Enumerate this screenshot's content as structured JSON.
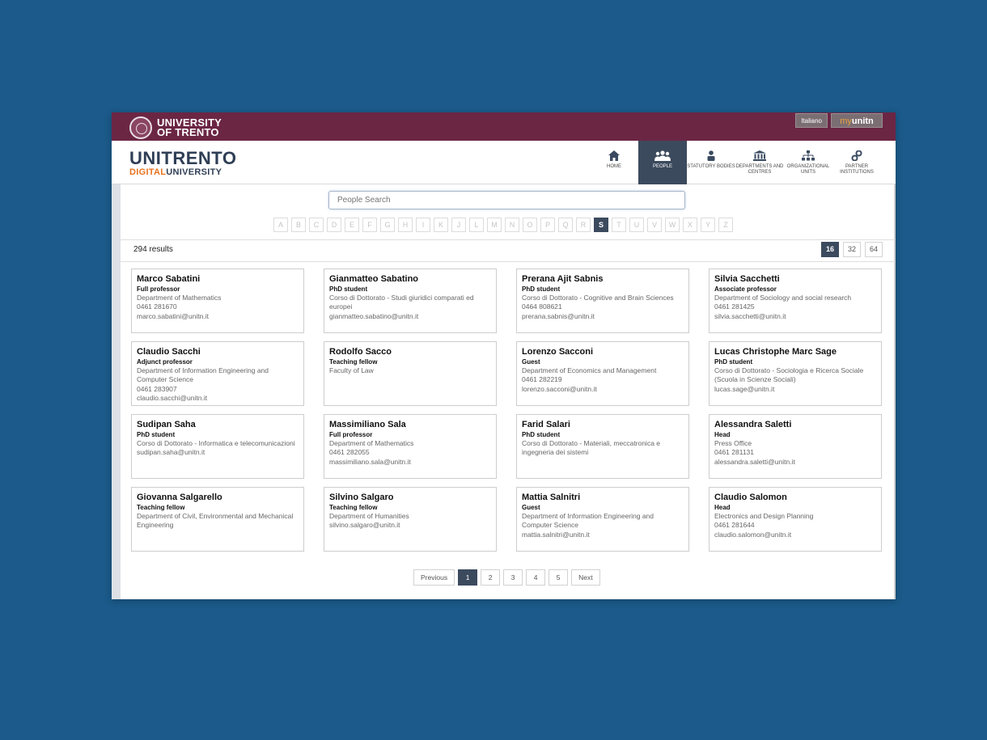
{
  "topbar": {
    "logo_line1": "UNIVERSITY",
    "logo_line2": "OF TRENTO",
    "language": "Italiano",
    "myunitn_prefix": "my",
    "myunitn_suffix": "unitn"
  },
  "brand": {
    "main": "UNITRENTO",
    "sub_highlight": "DIGITAL",
    "sub_rest": "UNIVERSITY"
  },
  "nav": [
    {
      "label": "HOME",
      "icon": "home-icon",
      "active": false
    },
    {
      "label": "PEOPLE",
      "icon": "people-icon",
      "active": true
    },
    {
      "label": "STATUTORY BODIES",
      "icon": "person-icon",
      "active": false
    },
    {
      "label": "DEPARTMENTS AND CENTRES",
      "icon": "building-icon",
      "active": false
    },
    {
      "label": "ORGANIZATIONAL UNITS",
      "icon": "org-chart-icon",
      "active": false
    },
    {
      "label": "PARTNER INSTITUTIONS",
      "icon": "link-icon",
      "active": false
    }
  ],
  "search": {
    "placeholder": "People Search"
  },
  "alphabet": [
    "A",
    "B",
    "C",
    "D",
    "E",
    "F",
    "G",
    "H",
    "I",
    "K",
    "J",
    "L",
    "M",
    "N",
    "O",
    "P",
    "Q",
    "R",
    "S",
    "T",
    "U",
    "V",
    "W",
    "X",
    "Y",
    "Z"
  ],
  "active_letter": "S",
  "results": {
    "label": "294 results"
  },
  "per_page": {
    "options": [
      "16",
      "32",
      "64"
    ],
    "selected": "16"
  },
  "people": [
    {
      "name": "Marco Sabatini",
      "role": "Full professor",
      "details": [
        "Department of Mathematics",
        "0461 281670",
        "marco.sabatini@unitn.it"
      ]
    },
    {
      "name": "Gianmatteo Sabatino",
      "role": "PhD student",
      "details": [
        "Corso di Dottorato - Studi giuridici comparati ed europei",
        "gianmatteo.sabatino@unitn.it"
      ]
    },
    {
      "name": "Prerana Ajit Sabnis",
      "role": "PhD student",
      "details": [
        "Corso di Dottorato - Cognitive and Brain Sciences",
        "0464 808621",
        "prerana.sabnis@unitn.it"
      ]
    },
    {
      "name": "Silvia Sacchetti",
      "role": "Associate professor",
      "details": [
        "Department of Sociology and social research",
        "0461 281425",
        "silvia.sacchetti@unitn.it"
      ]
    },
    {
      "name": "Claudio Sacchi",
      "role": "Adjunct professor",
      "details": [
        "Department of Information Engineering and Computer Science",
        "0461 283907",
        "claudio.sacchi@unitn.it"
      ]
    },
    {
      "name": "Rodolfo Sacco",
      "role": "Teaching fellow",
      "details": [
        "Faculty of Law"
      ]
    },
    {
      "name": "Lorenzo Sacconi",
      "role": "Guest",
      "details": [
        "Department of Economics and Management",
        "0461 282219",
        "lorenzo.sacconi@unitn.it"
      ]
    },
    {
      "name": "Lucas Christophe Marc Sage",
      "role": "PhD student",
      "details": [
        "Corso di Dottorato - Sociologia e Ricerca Sociale (Scuola in Scienze Sociali)",
        "lucas.sage@unitn.it"
      ]
    },
    {
      "name": "Sudipan Saha",
      "role": "PhD student",
      "details": [
        "Corso di Dottorato - Informatica e telecomunicazioni",
        "sudipan.saha@unitn.it"
      ]
    },
    {
      "name": "Massimiliano Sala",
      "role": "Full professor",
      "details": [
        "Department of Mathematics",
        "0461 282055",
        "massimiliano.sala@unitn.it"
      ]
    },
    {
      "name": "Farid Salari",
      "role": "PhD student",
      "details": [
        "Corso di Dottorato - Materiali, meccatronica e ingegneria dei sistemi"
      ]
    },
    {
      "name": "Alessandra Saletti",
      "role": "Head",
      "details": [
        "Press Office",
        "0461 281131",
        "alessandra.saletti@unitn.it"
      ]
    },
    {
      "name": "Giovanna Salgarello",
      "role": "Teaching fellow",
      "details": [
        "Department of Civil, Environmental and Mechanical Engineering"
      ]
    },
    {
      "name": "Silvino Salgaro",
      "role": "Teaching fellow",
      "details": [
        "Department of Humanities",
        "silvino.salgaro@unitn.it"
      ]
    },
    {
      "name": "Mattia Salnitri",
      "role": "Guest",
      "details": [
        "Department of Information Engineering and Computer Science",
        "mattia.salnitri@unitn.it"
      ]
    },
    {
      "name": "Claudio Salomon",
      "role": "Head",
      "details": [
        "Electronics and Design Planning",
        "0461 281644",
        "claudio.salomon@unitn.it"
      ]
    }
  ],
  "pagination": {
    "previous": "Previous",
    "pages": [
      "1",
      "2",
      "3",
      "4",
      "5"
    ],
    "current": "1",
    "next": "Next"
  },
  "colors": {
    "background": "#1b5a8a",
    "topbar": "#6b2644",
    "accent": "#3c4a5e",
    "brand_orange": "#e8711e"
  }
}
